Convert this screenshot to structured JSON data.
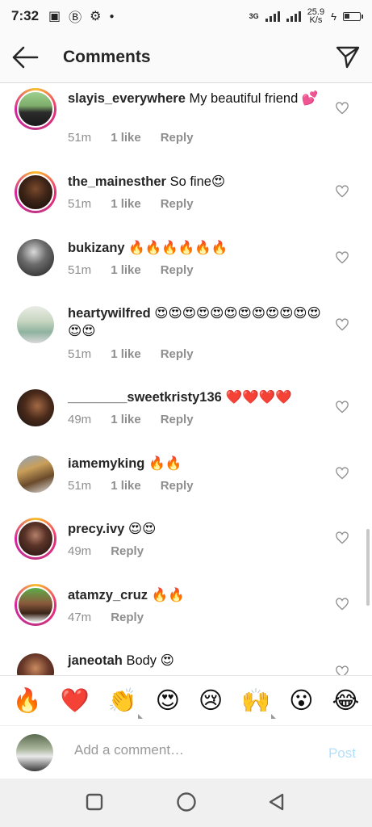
{
  "status": {
    "time": "7:32",
    "network": "3G",
    "speed_value": "25.9",
    "speed_unit": "K/s"
  },
  "header": {
    "title": "Comments"
  },
  "comments": [
    {
      "user": "slayis_everywhere",
      "text": "My beautiful friend 💕",
      "time": "51m",
      "likes": "1 like",
      "reply": "Reply"
    },
    {
      "user": "the_mainesther",
      "text": "So fine😍",
      "time": "51m",
      "likes": "1 like",
      "reply": "Reply"
    },
    {
      "user": "bukizany",
      "text": "🔥🔥🔥🔥🔥🔥",
      "time": "51m",
      "likes": "1 like",
      "reply": "Reply"
    },
    {
      "user": "heartywilfred",
      "text": "😍😍😍😍😍😍😍😍😍😍😍😍😍😍",
      "time": "51m",
      "likes": "1 like",
      "reply": "Reply"
    },
    {
      "user": "________sweetkristy136",
      "text": "❤️❤️❤️❤️",
      "time": "49m",
      "likes": "1 like",
      "reply": "Reply"
    },
    {
      "user": "iamemyking",
      "text": "🔥🔥",
      "time": "51m",
      "likes": "1 like",
      "reply": "Reply"
    },
    {
      "user": "precy.ivy",
      "text": "😍😍",
      "time": "49m",
      "reply": "Reply"
    },
    {
      "user": "atamzy_cruz",
      "text": "🔥🔥",
      "time": "47m",
      "reply": "Reply"
    },
    {
      "user": "janeotah",
      "text": "Body 😍"
    }
  ],
  "emojis": [
    "🔥",
    "❤️",
    "👏",
    "😍",
    "😢",
    "🙌",
    "😮",
    "😂"
  ],
  "composer": {
    "placeholder": "Add a comment…",
    "post": "Post"
  },
  "colors": {
    "ring_start": "#f9c02b",
    "ring_end": "#c13584",
    "post_disabled": "#b2dffc",
    "meta": "#8e8e8e"
  }
}
